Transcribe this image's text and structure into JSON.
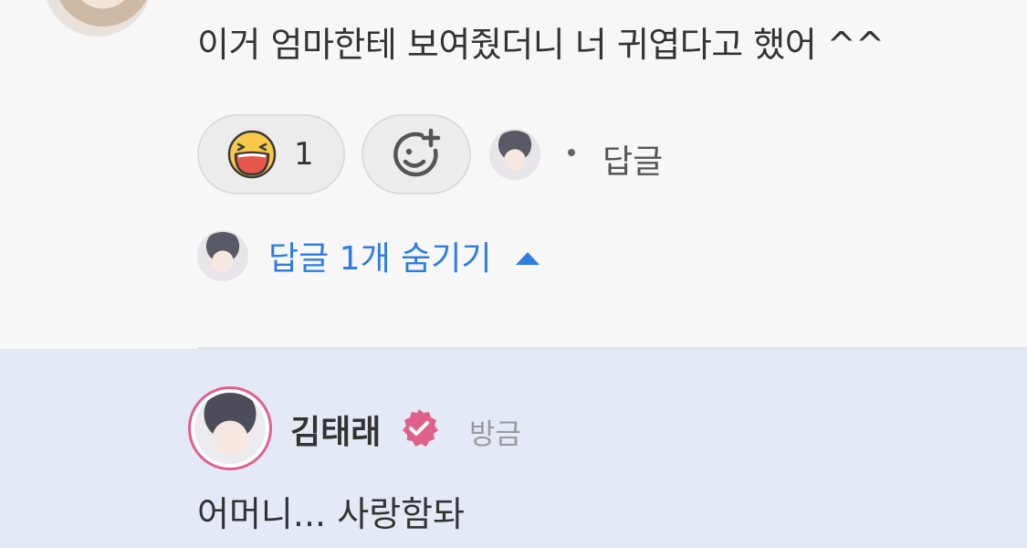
{
  "comment": {
    "text": "이거 엄마한테 보여줬더니 너 귀엽다고 했어 ^^",
    "reaction_count": "1",
    "reply_label": "답글",
    "hide_replies_label": "답글 1개 숨기기"
  },
  "reply": {
    "author": "김태래",
    "time": "방금",
    "text": "어머니... 사랑함돠"
  },
  "colors": {
    "link_blue": "#2f7de1",
    "verified_pink": "#e0608c",
    "reply_background": "#e3eaf6"
  }
}
